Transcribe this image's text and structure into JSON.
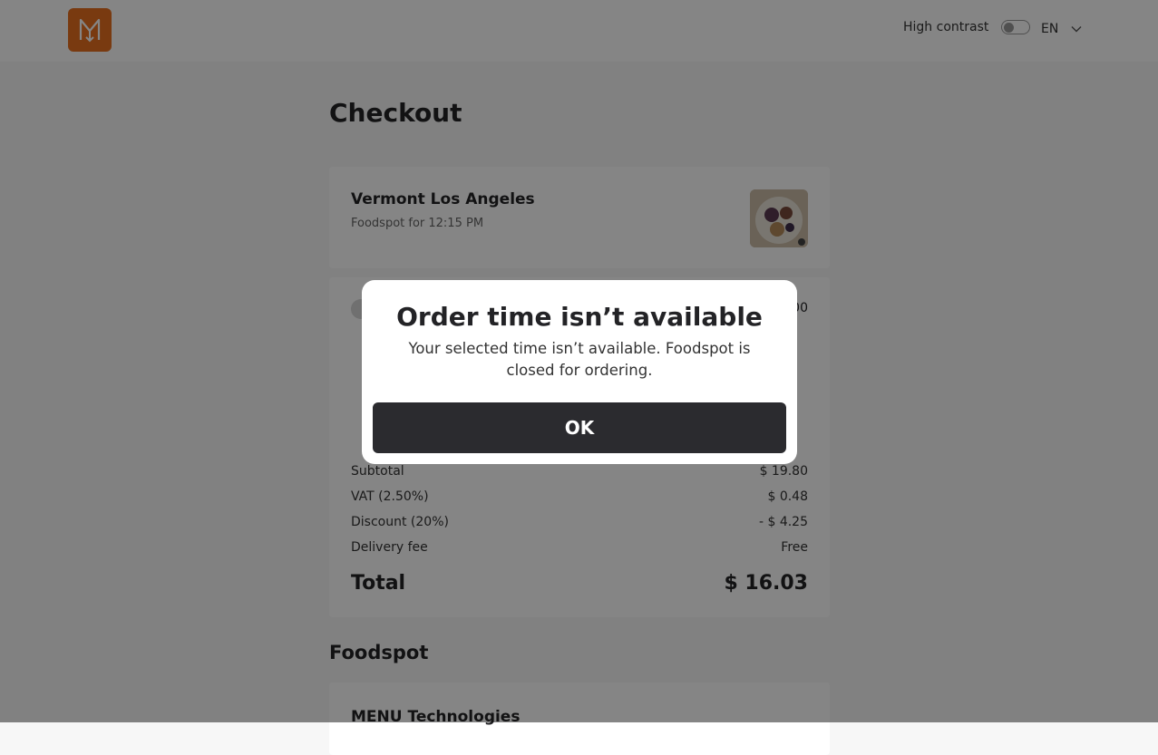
{
  "header": {
    "logo_icon": "menu-logo-icon",
    "high_contrast_label": "High contrast",
    "high_contrast_on": false,
    "language": "EN"
  },
  "page": {
    "title": "Checkout"
  },
  "restaurant": {
    "name": "Vermont Los Angeles",
    "subtitle": "Foodspot for 12:15 PM",
    "image_icon": "food-photo"
  },
  "summary": {
    "item_price_partial": "00",
    "rows": [
      {
        "label": "Subtotal",
        "value": "$ 19.80"
      },
      {
        "label": "VAT (2.50%)",
        "value": "$ 0.48"
      },
      {
        "label": "Discount (20%)",
        "value": "- $ 4.25"
      },
      {
        "label": "Delivery fee",
        "value": "Free"
      }
    ],
    "total_label": "Total",
    "total_value": "$ 16.03"
  },
  "foodspot": {
    "section_title": "Foodspot",
    "company_name": "MENU Technologies"
  },
  "modal": {
    "title": "Order time isn’t available",
    "message": "Your selected time isn’t available. Foodspot is closed for ordering.",
    "ok_label": "OK"
  },
  "colors": {
    "brand_orange": "#e8701f",
    "button_dark": "#2b2b2f"
  }
}
